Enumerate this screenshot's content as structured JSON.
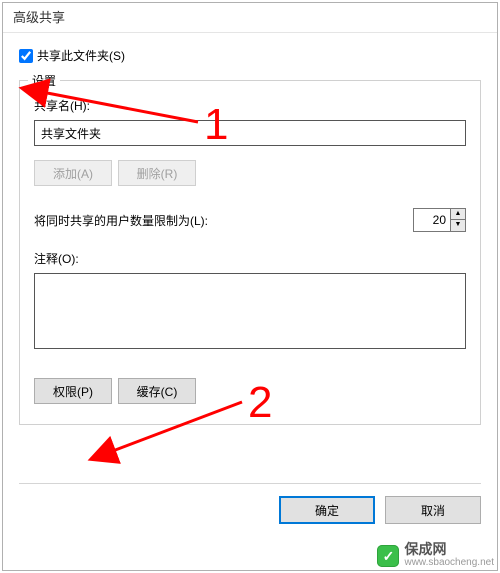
{
  "window": {
    "title": "高级共享"
  },
  "share_checkbox": {
    "label": "共享此文件夹(S)",
    "checked": true
  },
  "settings": {
    "legend": "设置",
    "share_name_label": "共享名(H):",
    "share_name_value": "共享文件夹",
    "add_button": "添加(A)",
    "remove_button": "删除(R)",
    "limit_label": "将同时共享的用户数量限制为(L):",
    "limit_value": "20",
    "comment_label": "注释(O):",
    "comment_value": "",
    "permissions_button": "权限(P)",
    "cache_button": "缓存(C)"
  },
  "footer": {
    "ok": "确定",
    "cancel": "取消"
  },
  "annotations": {
    "num1": "1",
    "num2": "2"
  },
  "watermark": {
    "badge": "✓",
    "cn": "保成网",
    "en": "www.sbaocheng.net"
  }
}
